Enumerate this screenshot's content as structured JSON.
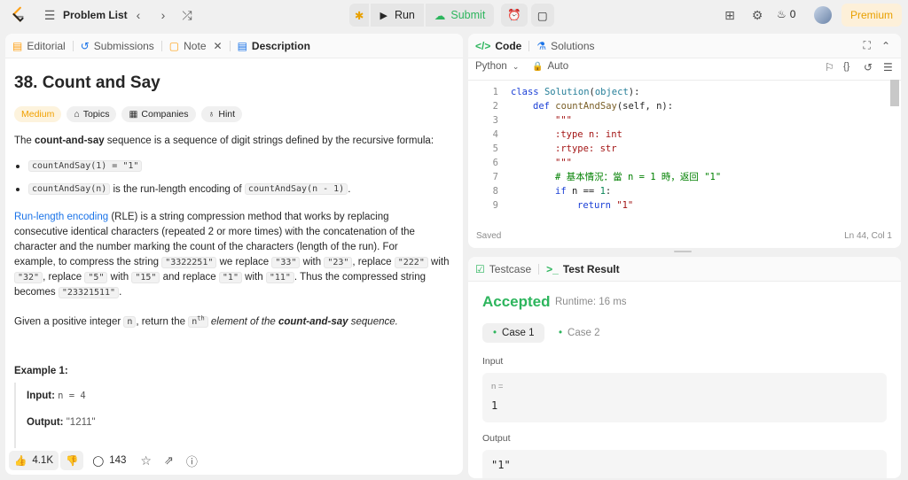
{
  "topbar": {
    "problem_list": "Problem List",
    "run": "Run",
    "submit": "Submit",
    "streak": "0",
    "premium": "Premium"
  },
  "left_tabs": [
    {
      "label": "Editorial"
    },
    {
      "label": "Submissions"
    },
    {
      "label": "Note"
    },
    {
      "label": "Description"
    }
  ],
  "problem": {
    "title": "38. Count and Say",
    "difficulty": "Medium",
    "topics": "Topics",
    "companies": "Companies",
    "hint": "Hint",
    "intro_pre": "The ",
    "intro_bold": "count-and-say",
    "intro_post": " sequence is a sequence of digit strings defined by the recursive formula:",
    "b1_code": "countAndSay(1) = \"1\"",
    "b2_code": "countAndSay(n)",
    "b2_text": " is the run-length encoding of ",
    "b2_code2": "countAndSay(n - 1)",
    "b2_end": ".",
    "rle_link": "Run-length encoding",
    "rle_l1": " (RLE) is a string compression method that works by replacing",
    "rle_l2": "consecutive identical characters (repeated 2 or more times) with the concatenation of the",
    "rle_l3": "character and the number marking the count of the characters (length of the run). For",
    "rle_l4a": "example, to compress the string ",
    "c1": "\"3322251\"",
    "rle_l4b": " we replace ",
    "c2": "\"33\"",
    "w1": " with ",
    "c3": "\"23\"",
    "w2": ", replace ",
    "c4": "\"222\"",
    "w3": " with",
    "c5": "\"32\"",
    "w4": ", replace ",
    "c6": "\"5\"",
    "w5": " with ",
    "c7": "\"15\"",
    "w6": " and replace ",
    "c8": "\"1\"",
    "w7": " with ",
    "c9": "\"11\"",
    "w8": ". Thus the compressed string",
    "w9": "becomes ",
    "c10": "\"23321511\"",
    "w10": ".",
    "given_pre": "Given a positive integer ",
    "given_n": "n",
    "given_mid": ", return the ",
    "given_sup_n": "n",
    "given_th": "th",
    "given_post1": " element of the ",
    "given_bold": "count-and-say",
    "given_post2": " sequence.",
    "example_title": "Example 1:",
    "input_label": "Input:",
    "input_val": "n = 4",
    "output_label": "Output:",
    "output_val": "\"1211\""
  },
  "bottom": {
    "likes": "4.1K",
    "comments": "143"
  },
  "code_tabs": [
    {
      "label": "Code"
    },
    {
      "label": "Solutions"
    }
  ],
  "editor": {
    "language": "Python",
    "auto": "Auto",
    "saved": "Saved",
    "cursor": "Ln 44, Col 1"
  },
  "code_lines": [
    "1",
    "2",
    "3",
    "4",
    "5",
    "6",
    "7",
    "8",
    "9"
  ],
  "code": {
    "l1a": "class ",
    "l1b": "Solution",
    "l1c": "(",
    "l1d": "object",
    "l1e": "):",
    "l2a": "def ",
    "l2b": "countAndSay",
    "l2c": "(self, n):",
    "l3": "\"\"\"",
    "l4": ":type n: int",
    "l5": ":rtype: str",
    "l6": "\"\"\"",
    "l7": "# 基本情況：當 n = 1 時，返回 \"1\"",
    "l8a": "if ",
    "l8b": "n == ",
    "l8c": "1",
    ":": ":",
    "l9a": "return ",
    "l9b": "\"1\""
  },
  "result_tabs": [
    {
      "label": "Testcase"
    },
    {
      "label": "Test Result"
    }
  ],
  "result": {
    "status": "Accepted",
    "runtime": "Runtime: 16 ms",
    "case1": "Case 1",
    "case2": "Case 2",
    "input_label": "Input",
    "input_var": "n =",
    "input_val": "1",
    "output_label": "Output",
    "output_val": "\"1\""
  },
  "colors": {
    "accepted": "#2db55d",
    "medium": "#f0a000",
    "link": "#1a73e8"
  }
}
